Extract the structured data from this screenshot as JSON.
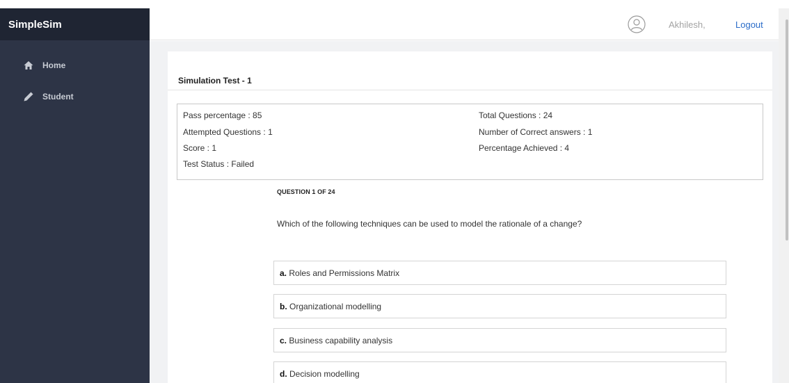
{
  "app": {
    "brand": "SimpleSim"
  },
  "sidebar": {
    "items": [
      {
        "label": "Home",
        "icon": "home-icon"
      },
      {
        "label": "Student",
        "icon": "pencil-icon"
      }
    ]
  },
  "header": {
    "username": "Akhilesh,",
    "logout_label": "Logout",
    "avatar_icon": "user-avatar-icon"
  },
  "test": {
    "title": "Simulation Test - 1",
    "stats": {
      "pass_percentage": "Pass percentage : 85",
      "attempted": "Attempted Questions : 1",
      "score": "Score : 1",
      "status": "Test Status : Failed",
      "total": "Total Questions : 24",
      "correct": "Number of Correct answers : 1",
      "achieved": "Percentage Achieved : 4"
    }
  },
  "question": {
    "counter": "QUESTION 1 OF 24",
    "text": "Which of the following techniques can be used to model the rationale of a change?",
    "options": [
      {
        "letter": "a.",
        "text": " Roles and Permissions Matrix"
      },
      {
        "letter": "b.",
        "text": " Organizational modelling"
      },
      {
        "letter": "c.",
        "text": " Business capability analysis"
      },
      {
        "letter": "d.",
        "text": " Decision modelling"
      }
    ]
  },
  "colors": {
    "sidebar_bg": "#2d3446",
    "brand_bg": "#1f2533",
    "link": "#2a6cc9",
    "content_bg": "#f1f2f4"
  }
}
